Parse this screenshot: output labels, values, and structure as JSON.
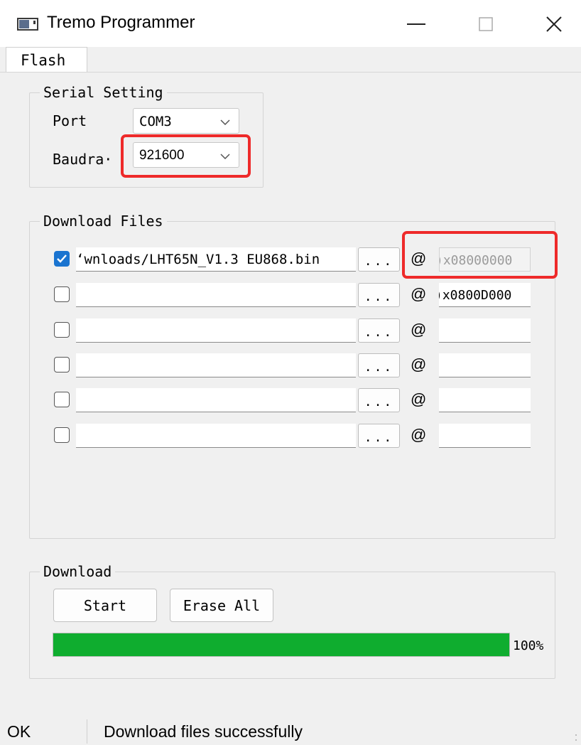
{
  "window": {
    "title": "Tremo Programmer",
    "controls": [
      "minimize-icon",
      "maximize-icon",
      "close-icon"
    ]
  },
  "tabs": [
    {
      "label": "Flash",
      "active": true
    }
  ],
  "serial_setting": {
    "title": "Serial Setting",
    "port_label": "Port",
    "port_value": "COM3",
    "baud_label": "Baudra·",
    "baud_value": "921600"
  },
  "download_files": {
    "title": "Download Files",
    "browse_label": "...",
    "at_symbol": "@",
    "rows": [
      {
        "checked": true,
        "path": "ʻwnloads/LHT65N_V1.3 EU868.bin",
        "address": ")x08000000",
        "address_disabled": true
      },
      {
        "checked": false,
        "path": "",
        "address": ")x0800D000",
        "address_disabled": false
      },
      {
        "checked": false,
        "path": "",
        "address": "",
        "address_disabled": false
      },
      {
        "checked": false,
        "path": "",
        "address": "",
        "address_disabled": false
      },
      {
        "checked": false,
        "path": "",
        "address": "",
        "address_disabled": false
      },
      {
        "checked": false,
        "path": "",
        "address": "",
        "address_disabled": false
      }
    ]
  },
  "download": {
    "title": "Download",
    "start_label": "Start",
    "erase_label": "Erase All",
    "progress_fraction": 1.0,
    "progress_text": "100%"
  },
  "status": {
    "left": "OK",
    "message": "Download files successfully"
  },
  "colors": {
    "accent": "#1a74d0",
    "progress": "#0fad2f",
    "highlight": "#ee2a2a"
  }
}
